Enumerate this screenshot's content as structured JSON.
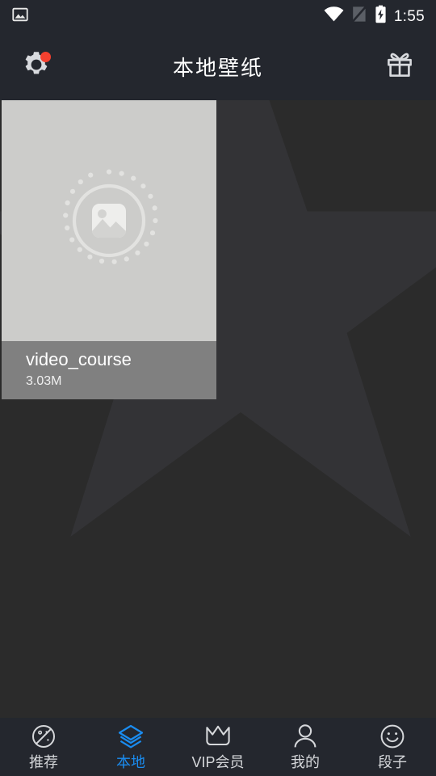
{
  "theme": {
    "bar_bg": "#24272E",
    "page_bg": "#2B2B2B",
    "star_fill": "#333336",
    "accent": "#1A8CF0",
    "badge_red": "#F4402F",
    "thumb_bg": "#CCCCCA",
    "meta_bg": "#808080"
  },
  "statusbar": {
    "notification_icon": "image-notification-icon",
    "wifi_icon": "wifi-icon",
    "signal_icon": "signal-off-icon",
    "battery_icon": "battery-charging-icon",
    "time": "1:55"
  },
  "appbar": {
    "title": "本地壁纸",
    "settings_icon": "gear-icon",
    "settings_badge": true,
    "gift_icon": "gift-icon"
  },
  "content": {
    "items": [
      {
        "title": "video_course",
        "size": "3.03M",
        "thumb_icon": "image-placeholder-icon"
      }
    ]
  },
  "bottomnav": {
    "items": [
      {
        "label": "推荐",
        "icon": "compass-icon",
        "active": false
      },
      {
        "label": "本地",
        "icon": "layers-icon",
        "active": true
      },
      {
        "label": "VIP会员",
        "icon": "crown-icon",
        "active": false
      },
      {
        "label": "我的",
        "icon": "person-icon",
        "active": false
      },
      {
        "label": "段子",
        "icon": "smiley-icon",
        "active": false
      }
    ]
  }
}
